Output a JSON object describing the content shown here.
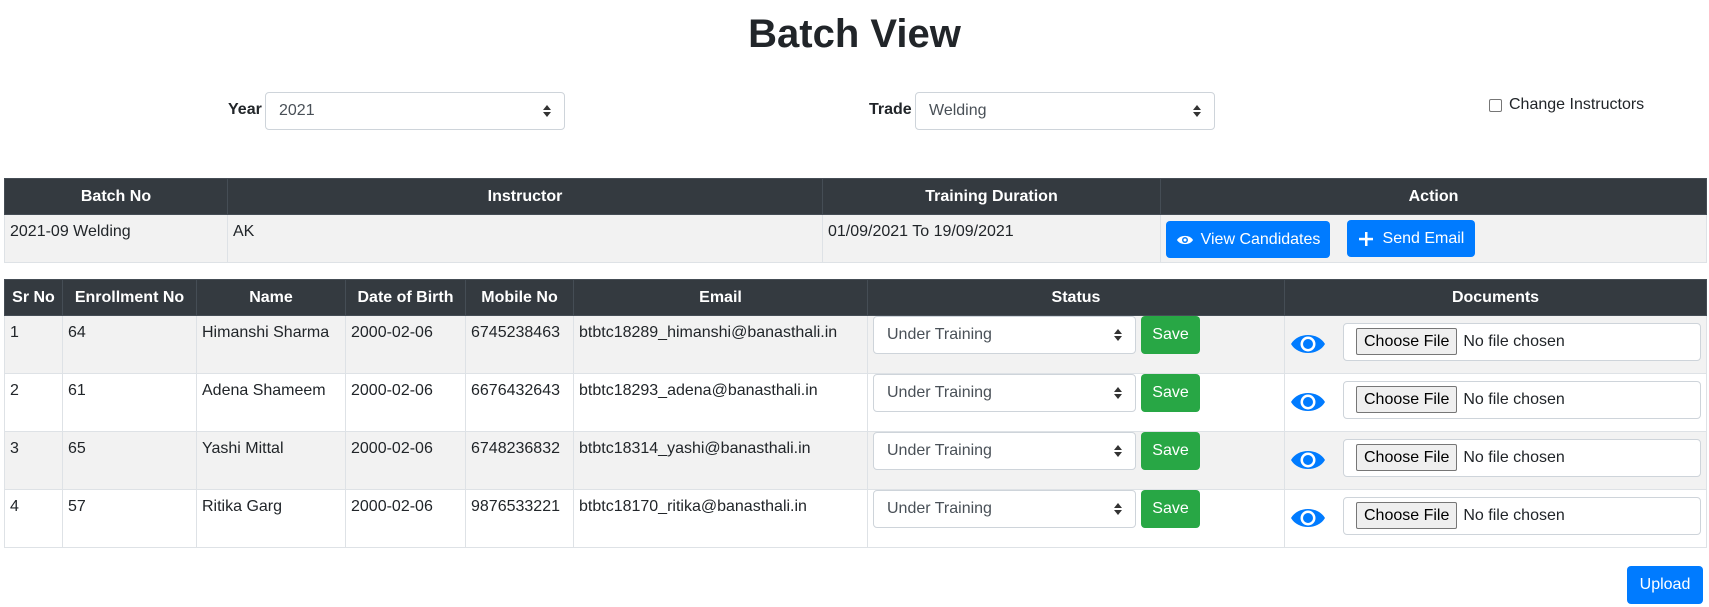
{
  "page": {
    "title": "Batch View"
  },
  "filters": {
    "year_label": "Year",
    "year_value": "2021",
    "trade_label": "Trade",
    "trade_value": "Welding",
    "change_instructors_label": "Change Instructors",
    "change_instructors_checked": false
  },
  "batch_table": {
    "headers": [
      "Batch No",
      "Instructor",
      "Training Duration",
      "Action"
    ],
    "row": {
      "batch_no": "2021-09 Welding",
      "instructor": "AK",
      "training_duration": "01/09/2021 To 19/09/2021",
      "view_label": "View Candidates",
      "email_label": "Send Email"
    }
  },
  "candidates_table": {
    "headers": [
      "Sr No",
      "Enrollment No",
      "Name",
      "Date of Birth",
      "Mobile No",
      "Email",
      "Status",
      "Documents"
    ],
    "rows": [
      {
        "sr": "1",
        "enrollment": "64",
        "name": "Himanshi Sharma",
        "dob": "2000-02-06",
        "mobile": "6745238463",
        "email": "btbtc18289_himanshi@banasthali.in",
        "status": "Under Training"
      },
      {
        "sr": "2",
        "enrollment": "61",
        "name": "Adena Shameem",
        "dob": "2000-02-06",
        "mobile": "6676432643",
        "email": "btbtc18293_adena@banasthali.in",
        "status": "Under Training"
      },
      {
        "sr": "3",
        "enrollment": "65",
        "name": "Yashi Mittal",
        "dob": "2000-02-06",
        "mobile": "6748236832",
        "email": "btbtc18314_yashi@banasthali.in",
        "status": "Under Training"
      },
      {
        "sr": "4",
        "enrollment": "57",
        "name": "Ritika Garg",
        "dob": "2000-02-06",
        "mobile": "9876533221",
        "email": "btbtc18170_ritika@banasthali.in",
        "status": "Under Training"
      }
    ],
    "save_label": "Save",
    "choose_file_label": "Choose File",
    "no_file_label": "No file chosen"
  },
  "upload_label": "Upload",
  "icons": {
    "view": "eye-icon",
    "email": "plus-icon",
    "sort": "select-arrows-icon"
  },
  "colors": {
    "header_bg": "#343a40",
    "primary": "#007bff",
    "success": "#28a745",
    "stripe": "#f2f2f2"
  }
}
